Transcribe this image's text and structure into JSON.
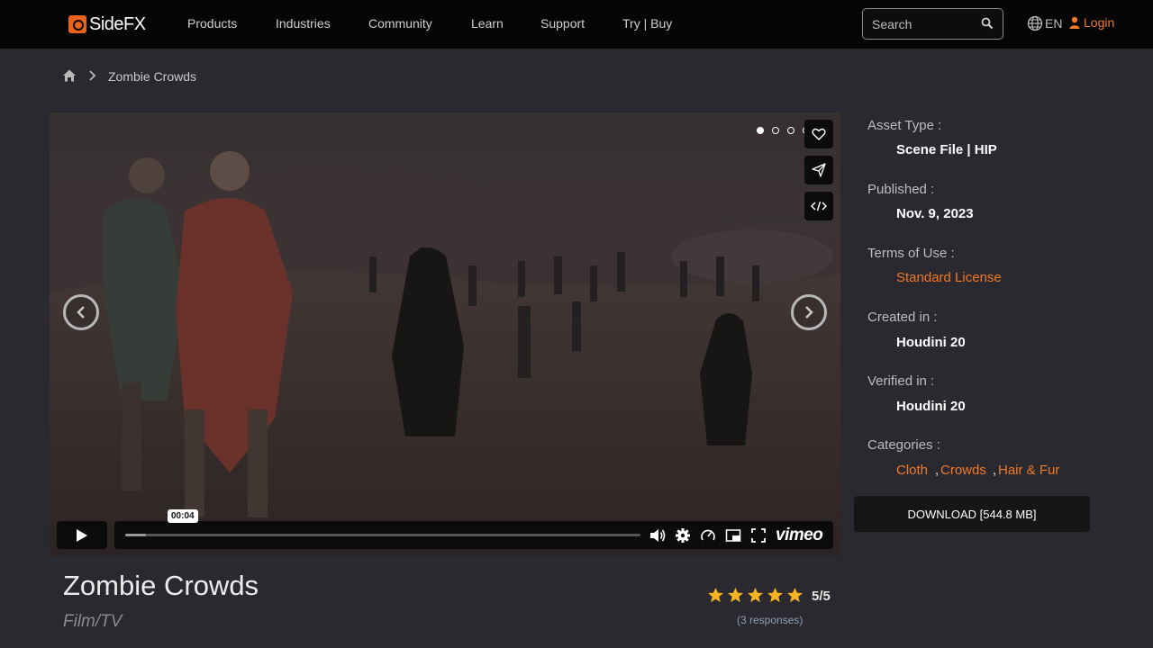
{
  "nav": {
    "logo": "SideFX",
    "items": [
      "Products",
      "Industries",
      "Community",
      "Learn",
      "Support",
      "Try | Buy"
    ],
    "search_placeholder": "Search",
    "language": "EN",
    "login": "Login"
  },
  "breadcrumb": {
    "current": "Zombie Crowds"
  },
  "video": {
    "carousel_dots": 4,
    "active_dot": 1,
    "time": "00:04",
    "progress": 0.04,
    "brand": "vimeo"
  },
  "asset": {
    "title": "Zombie Crowds",
    "subtitle": "Film/TV",
    "rating": {
      "stars": 5,
      "score": "5/5",
      "responses": "(3 responses)"
    }
  },
  "details": {
    "asset_type_label": "Asset Type :",
    "asset_type": "Scene File | HIP",
    "published_label": "Published :",
    "published": "Nov. 9, 2023",
    "terms_label": "Terms of Use :",
    "terms": "Standard License",
    "created_label": "Created in :",
    "created": "Houdini 20",
    "verified_label": "Verified in :",
    "verified": "Houdini 20",
    "categories_label": "Categories :",
    "categories": [
      "Cloth",
      "Crowds",
      "Hair & Fur"
    ],
    "download": "DOWNLOAD [544.8 MB]"
  },
  "colors": {
    "accent": "#f07a28",
    "background": "#2b2930",
    "nav_bg": "#050505",
    "star": "#f5b324"
  }
}
